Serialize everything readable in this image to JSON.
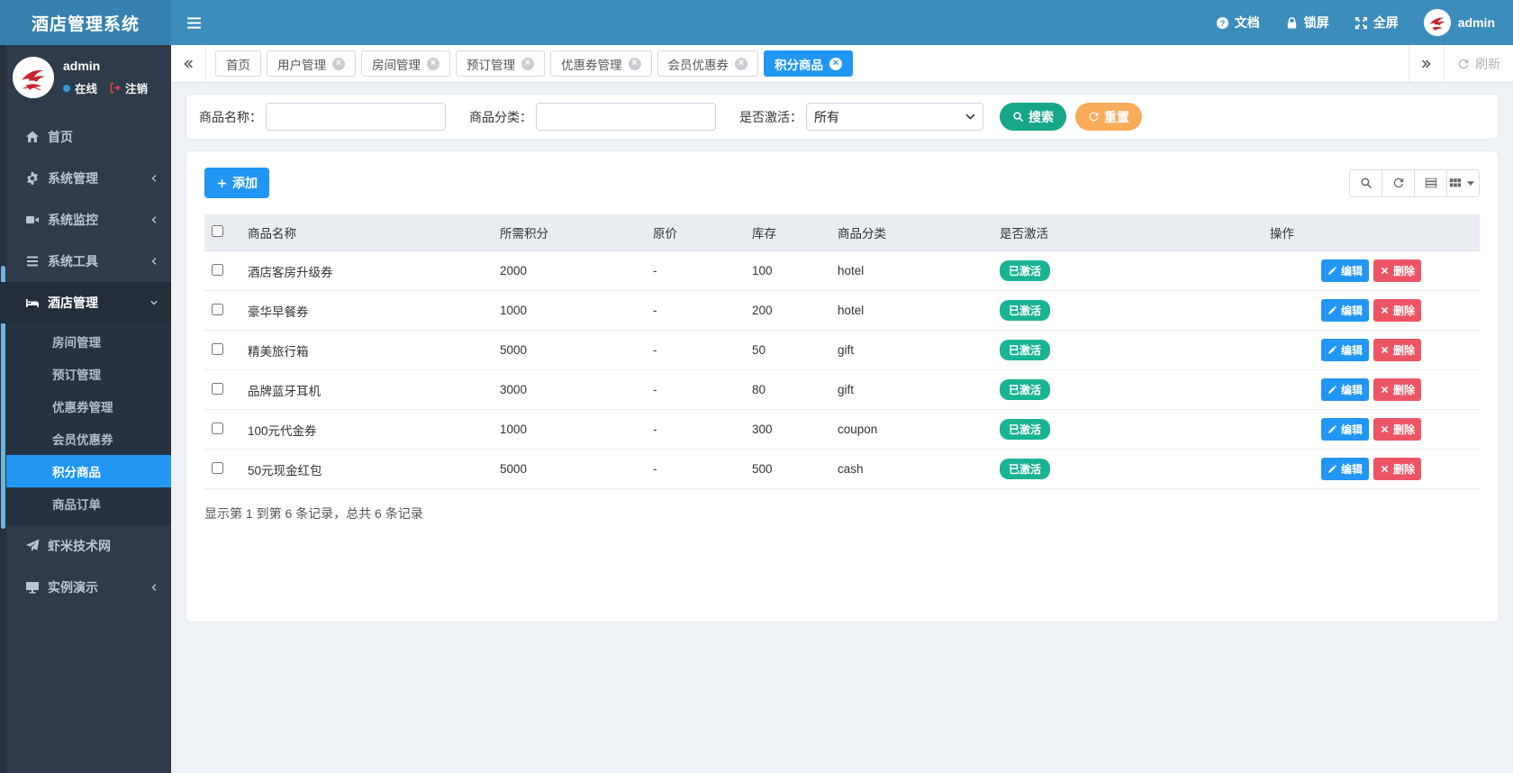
{
  "app": {
    "title": "酒店管理系统"
  },
  "colors": {
    "navbar": "#3c8dbc",
    "primary": "#2196f3",
    "success": "#1ab394",
    "warning": "#f8ac59",
    "danger": "#ed5565",
    "sidebar": "#2e3b4a"
  },
  "navbar": {
    "docs_label": "文档",
    "lock_label": "锁屏",
    "fullscreen_label": "全屏",
    "username": "admin"
  },
  "sidebar": {
    "username": "admin",
    "status_label": "在线",
    "logout_label": "注销",
    "menu": [
      {
        "label": "首页"
      },
      {
        "label": "系统管理"
      },
      {
        "label": "系统监控"
      },
      {
        "label": "系统工具"
      },
      {
        "label": "酒店管理"
      },
      {
        "label": "虾米技术网"
      },
      {
        "label": "实例演示"
      }
    ],
    "hotel_submenu": [
      {
        "label": "房间管理",
        "active": false
      },
      {
        "label": "预订管理",
        "active": false
      },
      {
        "label": "优惠券管理",
        "active": false
      },
      {
        "label": "会员优惠券",
        "active": false
      },
      {
        "label": "积分商品",
        "active": true
      },
      {
        "label": "商品订单",
        "active": false
      }
    ]
  },
  "tabbar": {
    "tabs": [
      {
        "label": "首页",
        "closable": false,
        "active": false
      },
      {
        "label": "用户管理",
        "closable": true,
        "active": false
      },
      {
        "label": "房间管理",
        "closable": true,
        "active": false
      },
      {
        "label": "预订管理",
        "closable": true,
        "active": false
      },
      {
        "label": "优惠券管理",
        "closable": true,
        "active": false
      },
      {
        "label": "会员优惠券",
        "closable": true,
        "active": false
      },
      {
        "label": "积分商品",
        "closable": true,
        "active": true
      }
    ],
    "refresh_label": "刷新"
  },
  "filters": {
    "name_label": "商品名称：",
    "name_value": "",
    "category_label": "商品分类：",
    "category_value": "",
    "active_label": "是否激活：",
    "active_selected": "所有",
    "search_label": "搜索",
    "reset_label": "重置"
  },
  "content": {
    "add_label": "添加",
    "table": {
      "headers": [
        "商品名称",
        "所需积分",
        "原价",
        "库存",
        "商品分类",
        "是否激活",
        "操作"
      ],
      "rows": [
        {
          "name": "酒店客房升级券",
          "points": "2000",
          "price": "-",
          "stock": "100",
          "category": "hotel",
          "status": "已激活"
        },
        {
          "name": "豪华早餐券",
          "points": "1000",
          "price": "-",
          "stock": "200",
          "category": "hotel",
          "status": "已激活"
        },
        {
          "name": "精美旅行箱",
          "points": "5000",
          "price": "-",
          "stock": "50",
          "category": "gift",
          "status": "已激活"
        },
        {
          "name": "品牌蓝牙耳机",
          "points": "3000",
          "price": "-",
          "stock": "80",
          "category": "gift",
          "status": "已激活"
        },
        {
          "name": "100元代金券",
          "points": "1000",
          "price": "-",
          "stock": "300",
          "category": "coupon",
          "status": "已激活"
        },
        {
          "name": "50元现金红包",
          "points": "5000",
          "price": "-",
          "stock": "500",
          "category": "cash",
          "status": "已激活"
        }
      ],
      "edit_label": "编辑",
      "delete_label": "删除",
      "summary": "显示第 1 到第 6 条记录，总共 6 条记录"
    }
  }
}
